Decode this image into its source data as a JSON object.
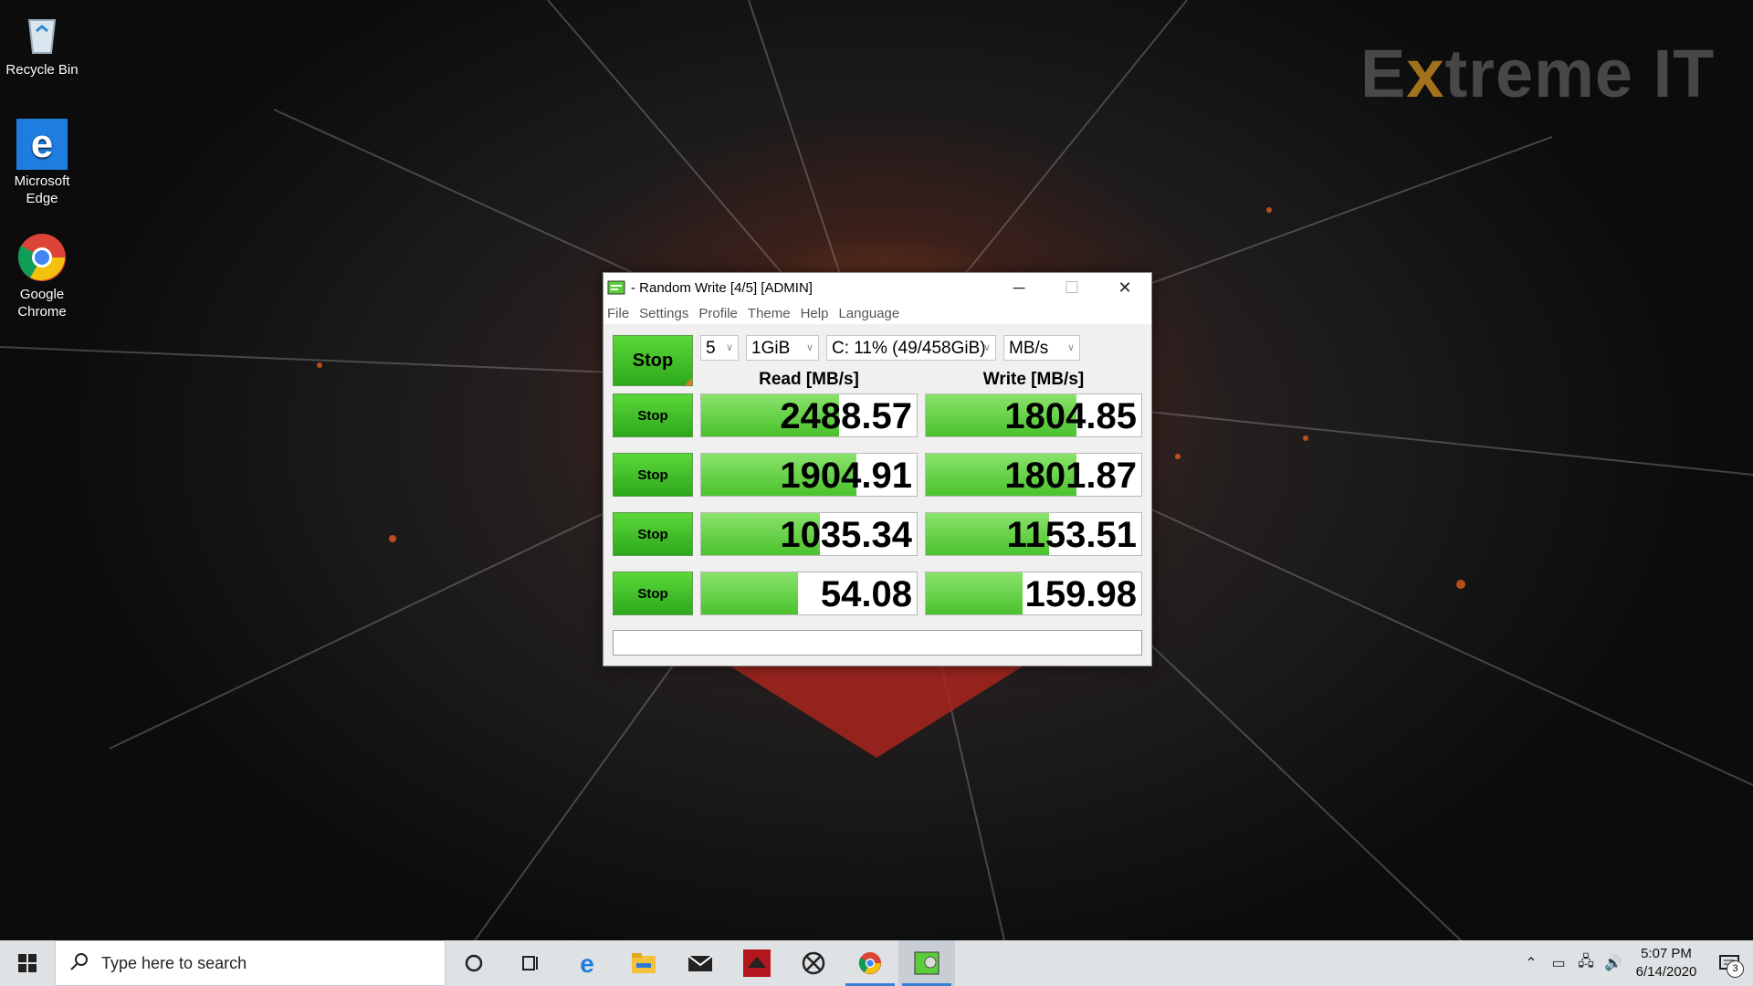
{
  "desktop": {
    "icons": [
      {
        "label": "Recycle Bin"
      },
      {
        "label": "Microsoft Edge"
      },
      {
        "label": "Google Chrome"
      }
    ],
    "watermark": {
      "lead": "E",
      "accent": "x",
      "rest": "treme IT"
    }
  },
  "window": {
    "title": "- Random Write [4/5] [ADMIN]",
    "controls": {
      "minimize": "─",
      "maximize": "☐",
      "close": "✕"
    },
    "menu": [
      "File",
      "Settings",
      "Profile",
      "Theme",
      "Help",
      "Language"
    ],
    "all_button": "Stop",
    "count": "5",
    "size": "1GiB",
    "drive": "C: 11% (49/458GiB)",
    "unit": "MB/s",
    "read_header": "Read [MB/s]",
    "write_header": "Write [MB/s]",
    "rows": [
      {
        "button": "Stop",
        "read": "2488.57",
        "read_level": 0.64,
        "write": "1804.85",
        "write_level": 0.7
      },
      {
        "button": "Stop",
        "read": "1904.91",
        "read_level": 0.72,
        "write": "1801.87",
        "write_level": 0.7
      },
      {
        "button": "Stop",
        "read": "1035.34",
        "read_level": 0.55,
        "write": "1153.51",
        "write_level": 0.57
      },
      {
        "button": "Stop",
        "read": "54.08",
        "read_level": 0.45,
        "write": "159.98",
        "write_level": 0.45
      }
    ],
    "status": ""
  },
  "taskbar": {
    "search_placeholder": "Type here to search",
    "apps": [
      "cortana-icon",
      "task-view-icon",
      "edge-icon",
      "file-explorer-icon",
      "mail-icon",
      "red-app-icon",
      "xbox-icon",
      "chrome-icon",
      "crystaldiskmark-icon"
    ],
    "active_app": "crystaldiskmark-icon",
    "time": "5:07 PM",
    "date": "6/14/2020",
    "notifications": "3"
  },
  "colors": {
    "accent_green": "#4ac22d",
    "taskbar": "#dfe2e4",
    "active_indicator": "#3a7fd6"
  }
}
